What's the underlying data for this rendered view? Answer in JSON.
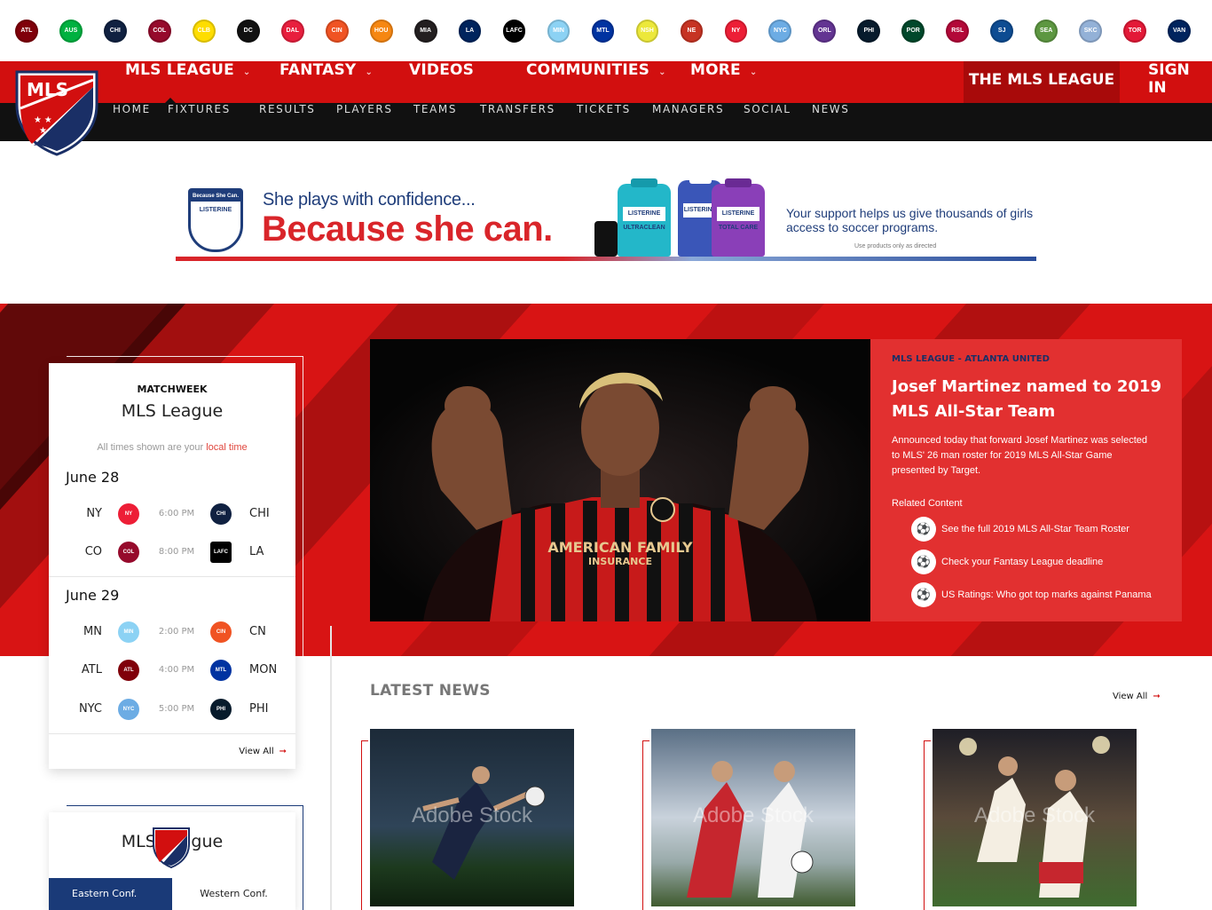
{
  "teams": [
    {
      "abbr": "ATL",
      "color": "#80000a",
      "icon": "atlanta-united-icon"
    },
    {
      "abbr": "AUS",
      "color": "#00b140",
      "icon": "austin-fc-icon"
    },
    {
      "abbr": "CHI",
      "color": "#102141",
      "icon": "chicago-fire-icon"
    },
    {
      "abbr": "COL",
      "color": "#960a2c",
      "icon": "colorado-rapids-icon"
    },
    {
      "abbr": "CLB",
      "color": "#fedd00",
      "icon": "columbus-crew-icon"
    },
    {
      "abbr": "DC",
      "color": "#111111",
      "icon": "dc-united-icon"
    },
    {
      "abbr": "DAL",
      "color": "#e81f3e",
      "icon": "fc-dallas-icon"
    },
    {
      "abbr": "CIN",
      "color": "#f05323",
      "icon": "fc-cincinnati-icon"
    },
    {
      "abbr": "HOU",
      "color": "#f68712",
      "icon": "houston-dynamo-icon"
    },
    {
      "abbr": "MIA",
      "color": "#231f20",
      "icon": "inter-miami-icon"
    },
    {
      "abbr": "LA",
      "color": "#00245d",
      "icon": "la-galaxy-icon"
    },
    {
      "abbr": "LAFC",
      "color": "#000000",
      "icon": "lafc-icon"
    },
    {
      "abbr": "MIN",
      "color": "#8cd2f4",
      "icon": "minnesota-united-icon"
    },
    {
      "abbr": "MTL",
      "color": "#0033a1",
      "icon": "montreal-impact-icon"
    },
    {
      "abbr": "NSH",
      "color": "#ece83a",
      "icon": "nashville-sc-icon"
    },
    {
      "abbr": "NE",
      "color": "#c63323",
      "icon": "new-england-revolution-icon"
    },
    {
      "abbr": "NY",
      "color": "#ed1e36",
      "icon": "ny-red-bulls-icon"
    },
    {
      "abbr": "NYC",
      "color": "#6cace4",
      "icon": "nycfc-icon"
    },
    {
      "abbr": "ORL",
      "color": "#633492",
      "icon": "orlando-city-icon"
    },
    {
      "abbr": "PHI",
      "color": "#071b2c",
      "icon": "philadelphia-union-icon"
    },
    {
      "abbr": "POR",
      "color": "#00482b",
      "icon": "portland-timbers-icon"
    },
    {
      "abbr": "RSL",
      "color": "#b30838",
      "icon": "real-salt-lake-icon"
    },
    {
      "abbr": "SJ",
      "color": "#0d4c92",
      "icon": "san-jose-earthquakes-icon"
    },
    {
      "abbr": "SEA",
      "color": "#5d9741",
      "icon": "seattle-sounders-icon"
    },
    {
      "abbr": "SKC",
      "color": "#93b1d7",
      "icon": "sporting-kc-icon"
    },
    {
      "abbr": "TOR",
      "color": "#e31937",
      "icon": "toronto-fc-icon"
    },
    {
      "abbr": "VAN",
      "color": "#00245e",
      "icon": "vancouver-whitecaps-icon"
    }
  ],
  "nav": {
    "items": [
      {
        "label": "MLS League",
        "dropdown": true
      },
      {
        "label": "Fantasy",
        "dropdown": true
      },
      {
        "label": "Videos",
        "dropdown": false
      },
      {
        "label": "Communities",
        "dropdown": true
      },
      {
        "label": "More",
        "dropdown": true
      }
    ],
    "league_button": "THE MLS LEAGUE",
    "sign_in": "SIGN IN",
    "chevron": "⌄"
  },
  "subnav": [
    "Home",
    "Fixtures",
    "Results",
    "Players",
    "Teams",
    "Transfers",
    "Tickets",
    "Managers",
    "Social",
    "News"
  ],
  "crest_label": "MLS",
  "banner": {
    "shield_top": "Because She Can.",
    "shield_brand": "LISTERINE",
    "line1": "She plays with confidence...",
    "line2": "Because she can.",
    "right_text": "Your support helps us give thousands of girls access to soccer programs.",
    "disclaimer": "Use products only as directed",
    "bottles": [
      "LISTERINE ULTRACLEAN",
      "LISTERINE",
      "LISTERINE TOTAL CARE"
    ]
  },
  "matches": {
    "eyebrow": "MATCHWEEK",
    "title": "MLS League",
    "time_note_prefix": "All times shown are your ",
    "time_note_link": "local time",
    "days": [
      {
        "date": "June 28",
        "games": [
          {
            "home": "NY",
            "away": "CHI",
            "time": "6:00 PM"
          },
          {
            "home": "CO",
            "away": "LA",
            "time": "8:00 PM"
          }
        ]
      },
      {
        "date": "June 29",
        "games": [
          {
            "home": "MN",
            "away": "CN",
            "time": "2:00 PM"
          },
          {
            "home": "ATL",
            "away": "MON",
            "time": "4:00 PM"
          },
          {
            "home": "NYC",
            "away": "PHI",
            "time": "5:00 PM"
          }
        ]
      }
    ],
    "view_all": "View All",
    "arrow": "➞"
  },
  "feature": {
    "eyebrow": "MLS LEAGUE - ATLANTA UNITED",
    "title": "Josef Martinez named to 2019 MLS All-Star Team",
    "body": "Announced today that forward Josef Martinez was selected to MLS' 26 man roster for 2019 MLS All-Star Game presented by Target.",
    "related_label": "Related Content",
    "related": [
      "See the full 2019 MLS All-Star Team Roster",
      "Check your Fantasy League deadline",
      "US Ratings: Who got top marks against Panama"
    ],
    "jersey_sponsor": "AMERICAN FAMILY",
    "jersey_sponsor2": "INSURANCE"
  },
  "latest_news": {
    "title": "LATEST NEWS",
    "view_all": "View All",
    "watermark": "Adobe Stock"
  },
  "standings": {
    "title": "MLS League",
    "tabs": [
      "Eastern Conf.",
      "Western Conf."
    ]
  }
}
